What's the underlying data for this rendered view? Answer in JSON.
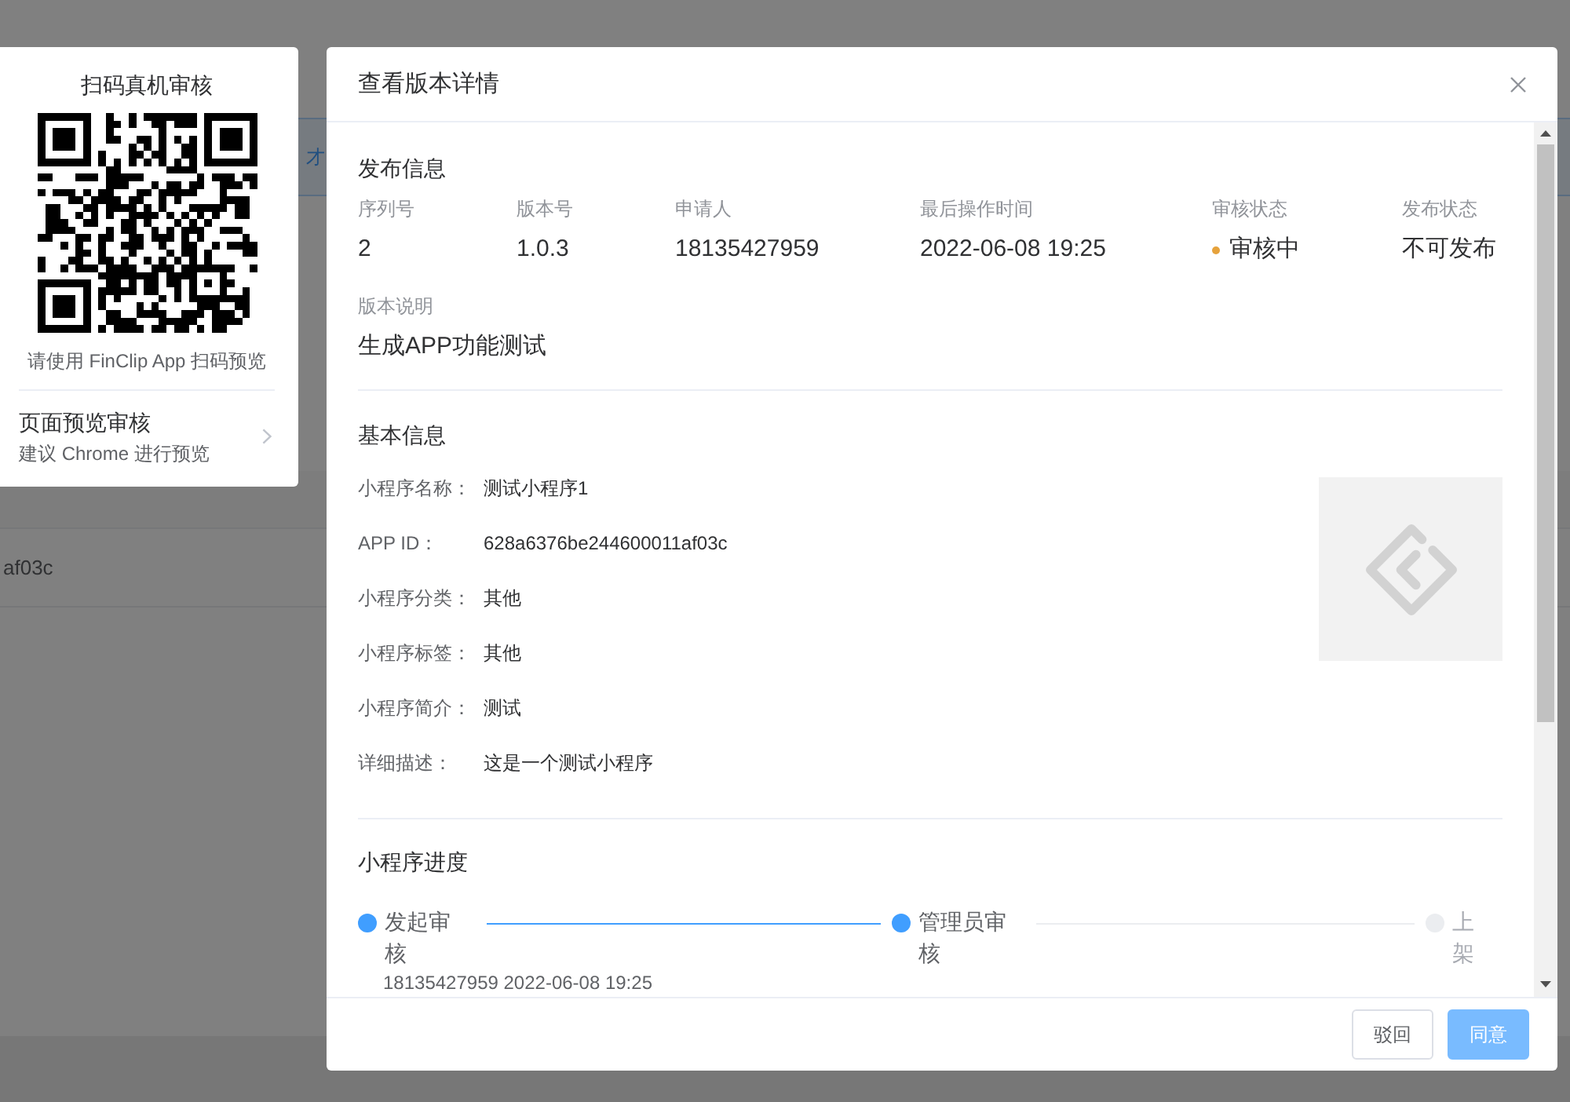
{
  "background": {
    "notice_text": "才",
    "table_cell": "af03c"
  },
  "preview_panel": {
    "title": "扫码真机审核",
    "caption": "请使用 FinClip App 扫码预览",
    "link_title": "页面预览审核",
    "link_subtitle": "建议 Chrome 进行预览"
  },
  "dialog": {
    "title": "查看版本详情",
    "release_info": {
      "heading": "发布信息",
      "fields": [
        {
          "label": "序列号",
          "value": "2",
          "kind": "text"
        },
        {
          "label": "版本号",
          "value": "1.0.3",
          "kind": "text"
        },
        {
          "label": "申请人",
          "value": "18135427959",
          "kind": "text"
        },
        {
          "label": "最后操作时间",
          "value": "2022-06-08 19:25",
          "kind": "text"
        },
        {
          "label": "审核状态",
          "value": "审核中",
          "kind": "status"
        },
        {
          "label": "发布状态",
          "value": "不可发布",
          "kind": "text"
        }
      ],
      "note_label": "版本说明",
      "note": "生成APP功能测试"
    },
    "basic_info": {
      "heading": "基本信息",
      "rows": [
        {
          "label": "小程序名称：",
          "value": "测试小程序1"
        },
        {
          "label": "APP ID：",
          "value": "628a6376be244600011af03c"
        },
        {
          "label": "小程序分类：",
          "value": "其他"
        },
        {
          "label": "小程序标签：",
          "value": "其他"
        },
        {
          "label": "小程序简介：",
          "value": "测试"
        },
        {
          "label": "详细描述：",
          "value": "这是一个测试小程序"
        }
      ]
    },
    "progress": {
      "heading": "小程序进度",
      "steps": [
        {
          "label": "发起审核",
          "reached": true,
          "detail": "18135427959 2022-06-08 19:25"
        },
        {
          "label": "管理员审核",
          "reached": true
        },
        {
          "label": "上架",
          "reached": false
        }
      ]
    },
    "buttons": [
      {
        "label": "驳回",
        "kind": "default"
      },
      {
        "label": "同意",
        "kind": "primary"
      }
    ]
  }
}
